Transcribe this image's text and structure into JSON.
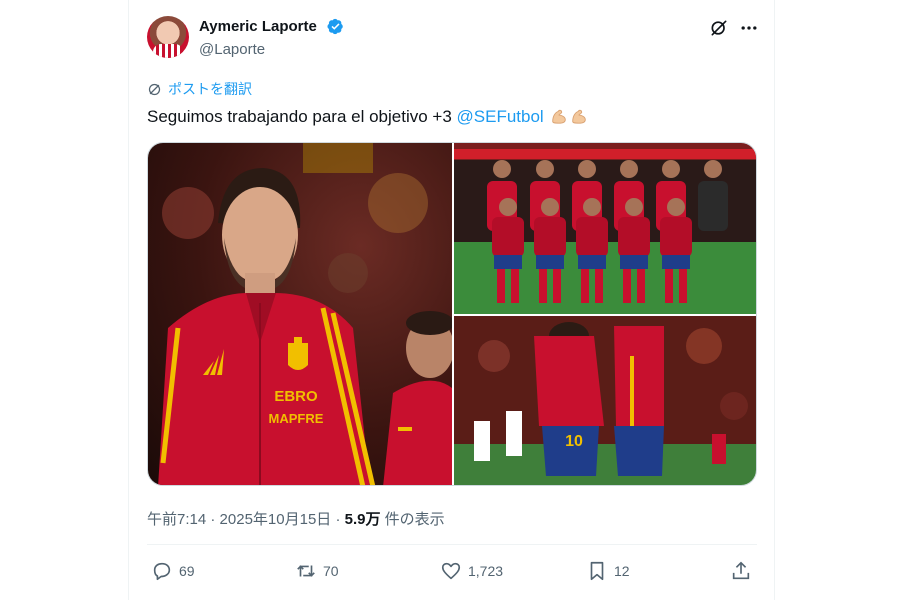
{
  "author": {
    "name": "Aymeric Laporte",
    "handle": "@Laporte",
    "verified": true
  },
  "translate_label": "ポストを翻訳",
  "tweet": {
    "text": "Seguimos trabajando para el objetivo +3 ",
    "mention": "@SEFutbol",
    "emoji": "💪🏼💪🏼"
  },
  "media": {
    "images": [
      {
        "label": "EBRO",
        "sublabel": "MAPFRE"
      },
      {
        "label": "team-photo"
      },
      {
        "label": "celebration",
        "number": "10"
      }
    ]
  },
  "meta": {
    "time": "午前7:14",
    "separator": " · ",
    "date": "2025年10月15日",
    "separator2": " · ",
    "views": "5.9万",
    "views_suffix": " 件の表示"
  },
  "actions": {
    "replies": "69",
    "reposts": "70",
    "likes": "1,723",
    "bookmarks": "12"
  },
  "colors": {
    "accent": "#1d9bf0",
    "text": "#0f1419",
    "secondary": "#536471",
    "spain_red": "#c8102e",
    "spain_yellow": "#f1bf00"
  }
}
